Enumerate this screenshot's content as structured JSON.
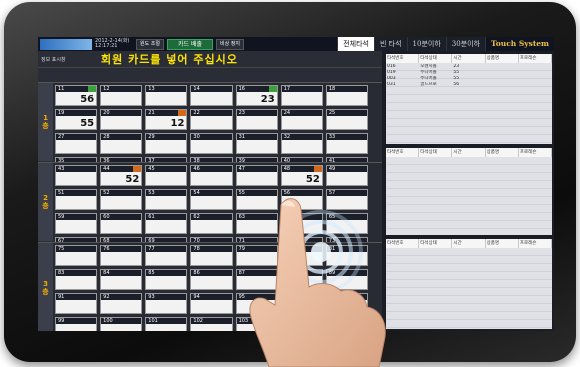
{
  "topbar": {
    "date": "2012-2-14(화)",
    "time": "12:17:21",
    "btn_a": "원도 조절",
    "btn_card": "카드 배출",
    "btn_b": "비상 정지",
    "tabs": [
      "전체타석",
      "빈 타석",
      "10분이하",
      "30분이하"
    ],
    "touch_system": "Touch System"
  },
  "main": {
    "status_label": "정보 표시창",
    "title": "회원 카드를 넣어 주십시오"
  },
  "floors": [
    {
      "label_num": "1",
      "label_unit": "층",
      "cells": [
        {
          "n": "11",
          "big": "56",
          "flag": "green"
        },
        {
          "n": "12",
          "big": "",
          "flag": ""
        },
        {
          "n": "13",
          "big": "",
          "flag": ""
        },
        {
          "n": "14",
          "big": "",
          "flag": ""
        },
        {
          "n": "16",
          "big": "23",
          "flag": "green"
        },
        {
          "n": "17",
          "big": "",
          "flag": ""
        },
        {
          "n": "18",
          "big": "",
          "flag": ""
        },
        {
          "n": "19",
          "big": "55",
          "flag": ""
        },
        {
          "n": "20",
          "big": "",
          "flag": ""
        },
        {
          "n": "21",
          "big": "12",
          "flag": "orange"
        },
        {
          "n": "22",
          "big": "",
          "flag": ""
        },
        {
          "n": "23",
          "big": "",
          "flag": ""
        },
        {
          "n": "24",
          "big": "",
          "flag": ""
        },
        {
          "n": "25",
          "big": "",
          "flag": ""
        },
        {
          "n": "27",
          "big": "",
          "flag": ""
        },
        {
          "n": "28",
          "big": "",
          "flag": ""
        },
        {
          "n": "29",
          "big": "",
          "flag": ""
        },
        {
          "n": "30",
          "big": "",
          "flag": ""
        },
        {
          "n": "31",
          "big": "",
          "flag": ""
        },
        {
          "n": "32",
          "big": "",
          "flag": ""
        },
        {
          "n": "33",
          "big": "",
          "flag": ""
        },
        {
          "n": "35",
          "big": "",
          "flag": ""
        },
        {
          "n": "36",
          "big": "",
          "flag": ""
        },
        {
          "n": "37",
          "big": "",
          "flag": ""
        },
        {
          "n": "38",
          "big": "",
          "flag": ""
        },
        {
          "n": "39",
          "big": "",
          "flag": ""
        },
        {
          "n": "40",
          "big": "",
          "flag": ""
        },
        {
          "n": "41",
          "big": "",
          "flag": ""
        }
      ]
    },
    {
      "label_num": "2",
      "label_unit": "층",
      "cells": [
        {
          "n": "43",
          "big": "",
          "flag": ""
        },
        {
          "n": "44",
          "big": "52",
          "flag": "orange"
        },
        {
          "n": "45",
          "big": "",
          "flag": ""
        },
        {
          "n": "46",
          "big": "",
          "flag": ""
        },
        {
          "n": "47",
          "big": "",
          "flag": ""
        },
        {
          "n": "48",
          "big": "52",
          "flag": "orange"
        },
        {
          "n": "49",
          "big": "",
          "flag": ""
        },
        {
          "n": "51",
          "big": "",
          "flag": ""
        },
        {
          "n": "52",
          "big": "",
          "flag": ""
        },
        {
          "n": "53",
          "big": "",
          "flag": ""
        },
        {
          "n": "54",
          "big": "",
          "flag": ""
        },
        {
          "n": "55",
          "big": "",
          "flag": ""
        },
        {
          "n": "56",
          "big": "",
          "flag": ""
        },
        {
          "n": "57",
          "big": "",
          "flag": ""
        },
        {
          "n": "59",
          "big": "",
          "flag": ""
        },
        {
          "n": "60",
          "big": "",
          "flag": ""
        },
        {
          "n": "61",
          "big": "",
          "flag": ""
        },
        {
          "n": "62",
          "big": "",
          "flag": ""
        },
        {
          "n": "63",
          "big": "",
          "flag": ""
        },
        {
          "n": "64",
          "big": "",
          "flag": ""
        },
        {
          "n": "65",
          "big": "",
          "flag": ""
        },
        {
          "n": "67",
          "big": "",
          "flag": ""
        },
        {
          "n": "68",
          "big": "",
          "flag": ""
        },
        {
          "n": "69",
          "big": "",
          "flag": ""
        },
        {
          "n": "70",
          "big": "",
          "flag": ""
        },
        {
          "n": "71",
          "big": "",
          "flag": ""
        },
        {
          "n": "72",
          "big": "",
          "flag": ""
        },
        {
          "n": "73",
          "big": "",
          "flag": ""
        }
      ]
    },
    {
      "label_num": "3",
      "label_unit": "층",
      "cells": [
        {
          "n": "75",
          "big": "",
          "flag": ""
        },
        {
          "n": "76",
          "big": "",
          "flag": ""
        },
        {
          "n": "77",
          "big": "",
          "flag": ""
        },
        {
          "n": "78",
          "big": "",
          "flag": ""
        },
        {
          "n": "79",
          "big": "",
          "flag": ""
        },
        {
          "n": "80",
          "big": "",
          "flag": ""
        },
        {
          "n": "81",
          "big": "",
          "flag": ""
        },
        {
          "n": "83",
          "big": "",
          "flag": ""
        },
        {
          "n": "84",
          "big": "",
          "flag": ""
        },
        {
          "n": "85",
          "big": "",
          "flag": ""
        },
        {
          "n": "86",
          "big": "",
          "flag": ""
        },
        {
          "n": "87",
          "big": "",
          "flag": ""
        },
        {
          "n": "88",
          "big": "",
          "flag": ""
        },
        {
          "n": "89",
          "big": "",
          "flag": ""
        },
        {
          "n": "91",
          "big": "",
          "flag": ""
        },
        {
          "n": "92",
          "big": "",
          "flag": ""
        },
        {
          "n": "93",
          "big": "",
          "flag": ""
        },
        {
          "n": "94",
          "big": "",
          "flag": ""
        },
        {
          "n": "95",
          "big": "",
          "flag": ""
        },
        {
          "n": "96",
          "big": "",
          "flag": ""
        },
        {
          "n": "97",
          "big": "",
          "flag": ""
        },
        {
          "n": "99",
          "big": "",
          "flag": ""
        },
        {
          "n": "100",
          "big": "",
          "flag": ""
        },
        {
          "n": "101",
          "big": "",
          "flag": ""
        },
        {
          "n": "102",
          "big": "",
          "flag": ""
        },
        {
          "n": "103",
          "big": "",
          "flag": ""
        },
        {
          "n": "104",
          "big": "",
          "flag": ""
        },
        {
          "n": "105",
          "big": "",
          "flag": ""
        }
      ]
    }
  ],
  "panels": [
    {
      "headers": [
        "타석번호",
        "타석상태",
        "시간",
        "상품명",
        "프로레슨"
      ],
      "rows": [
        [
          "016",
          "오렌지볼",
          "23",
          "",
          ""
        ],
        [
          "019",
          "주니어볼",
          "55",
          "",
          ""
        ],
        [
          "003",
          "주니어볼",
          "55",
          "",
          ""
        ],
        [
          "031",
          "골드프로",
          "56",
          "",
          ""
        ]
      ]
    },
    {
      "headers": [
        "타석번호",
        "타석상태",
        "시간",
        "상품명",
        "프로레슨"
      ],
      "rows": []
    },
    {
      "headers": [
        "타석번호",
        "타석상태",
        "시간",
        "상품명",
        "프로레슨"
      ],
      "rows": []
    }
  ],
  "colors": {
    "title": "#ffe600",
    "floor_label": "#f5b000",
    "flag_green": "#3ca13c",
    "flag_orange": "#d2691e"
  }
}
